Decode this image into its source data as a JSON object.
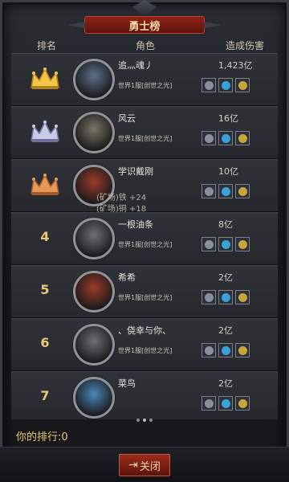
{
  "panel": {
    "title": "勇士榜"
  },
  "columns": {
    "rank": "排名",
    "role": "角色",
    "damage": "造成伤害"
  },
  "rows": [
    {
      "rank": "",
      "crown": "gold",
      "name": "追灬魂丿",
      "server": "世界1服[创世之光]",
      "damage": "1,423亿",
      "avatar_color": "#5a6f8a"
    },
    {
      "rank": "",
      "crown": "silver",
      "name": "风云",
      "server": "世界1服[创世之光]",
      "damage": "16亿",
      "avatar_color": "#7b7466"
    },
    {
      "rank": "",
      "crown": "bronze",
      "name": "学识戴刚",
      "server": "",
      "damage": "10亿",
      "avatar_color": "#9b3a2a"
    },
    {
      "rank": "4",
      "crown": "",
      "name": "一根油条",
      "server": "世界1服[创世之光]",
      "damage": "8亿",
      "avatar_color": "#6b6e73"
    },
    {
      "rank": "5",
      "crown": "",
      "name": "希希",
      "server": "世界1服[创世之光]",
      "damage": "2亿",
      "avatar_color": "#9b3a2a"
    },
    {
      "rank": "6",
      "crown": "",
      "name": "、侥幸与你、",
      "server": "世界1服[创世之光]",
      "damage": "2亿",
      "avatar_color": "#6b6e73"
    },
    {
      "rank": "7",
      "crown": "",
      "name": "菜鸟",
      "server": "",
      "damage": "2亿",
      "avatar_color": "#4a86b8"
    }
  ],
  "overlay": {
    "line1": "(矿场)铁 +24",
    "line2": "(矿场)铜 +18"
  },
  "footer": {
    "your_rank": "你的排行:0",
    "close_label": "关闭"
  },
  "item_colors": [
    "#8a8fa0",
    "#3aa0d8",
    "#c9a63a"
  ]
}
